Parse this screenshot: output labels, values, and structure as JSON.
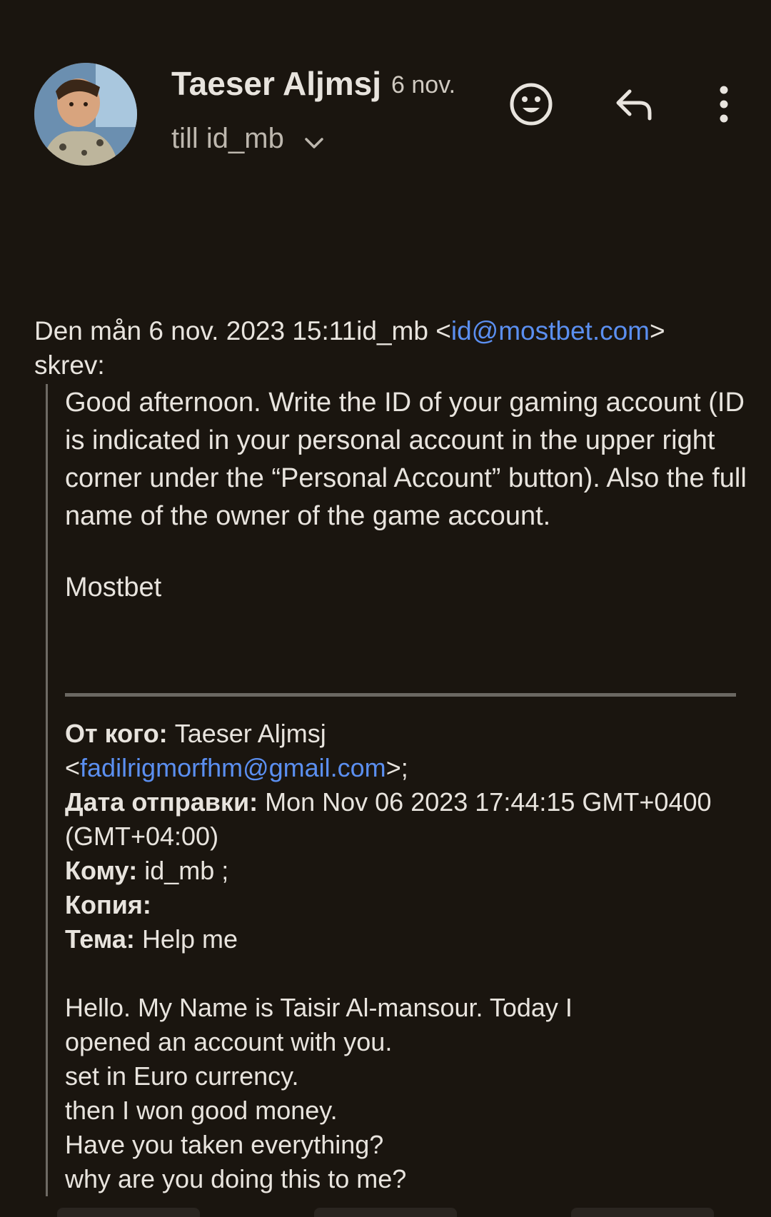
{
  "header": {
    "sender_name": "Taeser Aljmsj",
    "date": "6 nov.",
    "recipient": "till id_mb",
    "icons": [
      "emoji-reaction-icon",
      "reply-icon",
      "more-vert-icon",
      "chevron-down-icon"
    ]
  },
  "quote": {
    "intro_prefix": "Den mån 6 nov. 2023 15:11id_mb <",
    "intro_email": "id@mostbet.com",
    "intro_suffix_1": ">",
    "intro_suffix_2": "skrev:",
    "paragraph": "Good afternoon. Write the ID of your gaming account (ID is indicated in your personal account in the upper right corner under the “Personal Account” button). Also the full name of the owner of the game account.",
    "signature": "Mostbet"
  },
  "forwarded": {
    "from_label": "От кого:",
    "from_name": "Taeser Aljmsj",
    "from_email_prefix": "<",
    "from_email": "fadilrigmorfhm@gmail.com",
    "from_email_suffix": ">;",
    "date_label": "Дата отправки:",
    "date_value": "Mon Nov 06 2023 17:44:15 GMT+0400 (GMT+04:00)",
    "to_label": "Кому:",
    "to_value": "id_mb ;",
    "cc_label": "Копия:",
    "subject_label": "Тема:",
    "subject_value": "Help me",
    "body_lines": [
      "Hello. My Name is Taisir Al-mansour. Today I",
      "opened an account with you.",
      "set in Euro currency.",
      "then I won good money.",
      "Have you taken everything?",
      "why are you doing this to me?"
    ]
  },
  "colors": {
    "background": "#1a150f",
    "text": "#e8e4de",
    "link": "#5b8ff0",
    "divider": "#6b6862"
  }
}
